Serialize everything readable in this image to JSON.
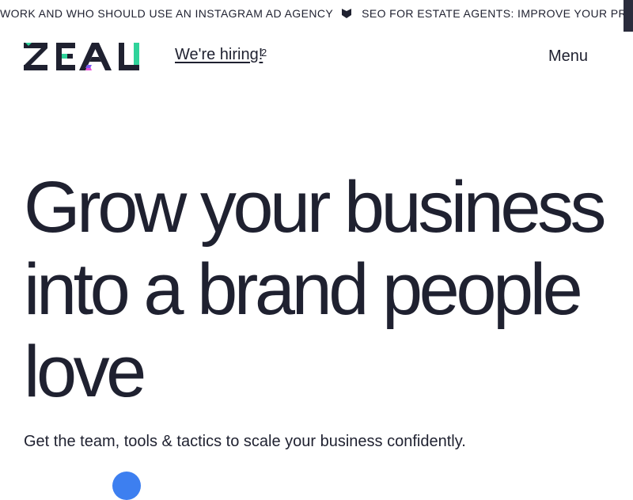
{
  "ticker": {
    "items": [
      "WORK AND WHO SHOULD USE AN INSTAGRAM AD AGENCY",
      "SEO FOR ESTATE AGENTS: IMPROVE YOUR PROPERTY"
    ],
    "separator_icon": "zeal-chevron-icon"
  },
  "header": {
    "logo_text": "ZEAL",
    "hiring_label": "We're hiring!",
    "hiring_count": "2",
    "menu_label": "Menu"
  },
  "hero": {
    "lines": [
      "Grow your business",
      "into a brand people",
      "love"
    ],
    "subtitle": "Get the team, tools & tactics to scale your business confidently."
  },
  "colors": {
    "text": "#1f2130",
    "accent_green": "#2fd39a",
    "accent_pink": "#e54fd6",
    "accent_purple": "#7b5cf0",
    "accent_blue": "#3d7ff0"
  }
}
